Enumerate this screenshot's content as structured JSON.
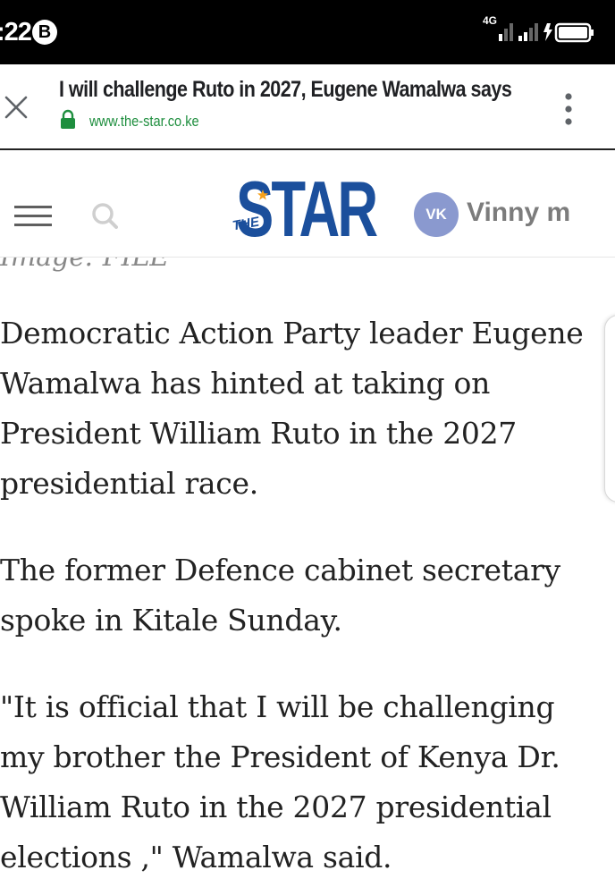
{
  "status_bar": {
    "time": ":22",
    "badge_letter": "B",
    "network": "4G",
    "icons": [
      "network-type-icon",
      "signal-icon",
      "signal-icon",
      "battery-charging-icon"
    ]
  },
  "tab": {
    "title": "I will challenge Ruto in 2027, Eugene Wamalwa says",
    "url": "www.the-star.co.ke",
    "icons": [
      "close-icon",
      "lock-icon",
      "more-vert-icon"
    ],
    "colors": {
      "url": "#1e8e3e",
      "lock": "#1e8e3e"
    }
  },
  "site_header": {
    "logo_the": "THE",
    "logo_star": "STAR",
    "avatar_initials": "VK",
    "user_name": "Vinny m",
    "icons": [
      "menu-icon",
      "search-icon"
    ],
    "colors": {
      "logo": "#1b4f9c",
      "logo_accent": "#f7a11a",
      "avatar": "#8a99cf"
    }
  },
  "article": {
    "image_caption": "Image: FILE",
    "paragraphs": [
      "Democratic Action Party leader Eugene Wamalwa has hinted at taking on President William Ruto in the 2027 presidential race.",
      "The former Defence cabinet secretary spoke in Kitale Sunday.",
      "\"It is official that I will be challenging my brother the President of Kenya Dr. William Ruto in the 2027 presidential elections ,\" Wamalwa said."
    ]
  }
}
